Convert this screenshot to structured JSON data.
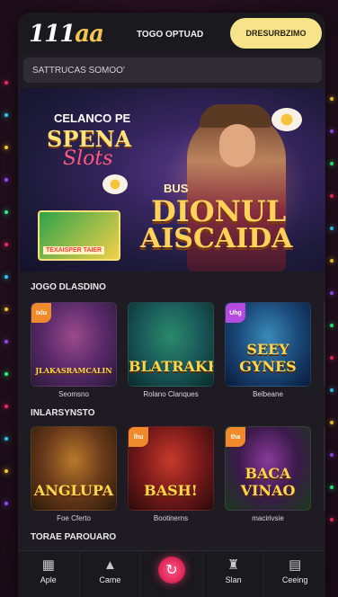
{
  "header": {
    "logo_main": "111",
    "logo_accent": "aa",
    "label": "TOGO OPTUAD",
    "cta_label": "DRESURBZIMO"
  },
  "search": {
    "placeholder": "SATTRUCAS SOMOO'"
  },
  "banner": {
    "subtitle": "CELANCO PE",
    "title_line1": "SPENA",
    "title_line2": "Slots",
    "big_small": "BUS",
    "big_line1": "DIONUL",
    "big_line2": "AISCAIDA",
    "mini_label": "TEXAISPER TAIER"
  },
  "sections": [
    {
      "title": "JOGO DLASDINO",
      "cards": [
        {
          "art": "JLAKASRAMCALIN",
          "name": "Seomsno",
          "badge": "Ixlu",
          "badge_color": "orange",
          "colors": [
            "#5a2a6a",
            "#9a4a8a",
            "#2a1a3a"
          ]
        },
        {
          "art": "BLATRAKH",
          "name": "Rolano Clanques",
          "badge": "",
          "badge_color": "",
          "colors": [
            "#1a5a5a",
            "#2a8a6a",
            "#0a2a2a"
          ]
        },
        {
          "art": "SEEY GYNES",
          "name": "Belbeane",
          "badge": "Uhg",
          "badge_color": "purple",
          "colors": [
            "#1a4a7a",
            "#3a8ab8",
            "#0a1a3a"
          ]
        }
      ]
    },
    {
      "title": "INLARSYNSTO",
      "cards": [
        {
          "art": "ANGLUPA",
          "name": "Foe Cferto",
          "badge": "",
          "badge_color": "",
          "colors": [
            "#6a3a1a",
            "#b87a2a",
            "#2a1a0a"
          ]
        },
        {
          "art": "BASH!",
          "name": "Bootinerns",
          "badge": "lhu",
          "badge_color": "orange",
          "colors": [
            "#7a1a1a",
            "#c83a2a",
            "#2a0a0a"
          ]
        },
        {
          "art": "BACA VINAO",
          "name": "macirivsie",
          "badge": "tha",
          "badge_color": "orange",
          "colors": [
            "#3a1a4a",
            "#8a3a9a",
            "#1a3a1a"
          ]
        }
      ]
    }
  ],
  "section3_title": "TORAE PAROUARO",
  "bottom_nav": [
    {
      "label": "Aple",
      "icon": "grid-icon",
      "glyph": "▦"
    },
    {
      "label": "Came",
      "icon": "triangle-icon",
      "glyph": "▲"
    },
    {
      "label": "",
      "icon": "refresh-icon",
      "glyph": "↻"
    },
    {
      "label": "Slan",
      "icon": "hat-icon",
      "glyph": "♜"
    },
    {
      "label": "Ceeing",
      "icon": "cards-icon",
      "glyph": "▤"
    }
  ],
  "edge_light_colors": [
    "#ff2a6a",
    "#2ad4ff",
    "#ffd42a",
    "#9a4aff",
    "#2aff8a"
  ]
}
